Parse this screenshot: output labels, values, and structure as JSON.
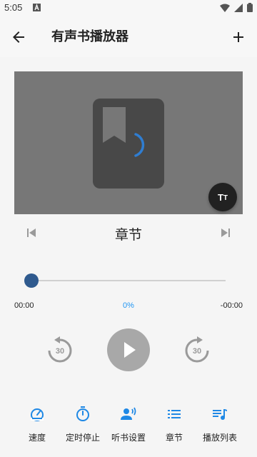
{
  "status_bar": {
    "time": "5:05"
  },
  "app_bar": {
    "title": "有声书播放器"
  },
  "cover": {
    "text_size_button": {
      "big": "T",
      "small": "T"
    }
  },
  "player": {
    "chapter_title": "章节",
    "progress": 0,
    "time_elapsed": "00:00",
    "progress_percent": "0%",
    "time_remaining": "-00:00",
    "rewind_seconds": "30",
    "forward_seconds": "30"
  },
  "bottom_nav": {
    "items": [
      {
        "label": "速度",
        "icon": "speedometer-icon"
      },
      {
        "label": "定时停止",
        "icon": "timer-icon"
      },
      {
        "label": "听书设置",
        "icon": "voice-settings-icon"
      },
      {
        "label": "章节",
        "icon": "list-icon"
      },
      {
        "label": "播放列表",
        "icon": "playlist-icon"
      }
    ]
  },
  "colors": {
    "accent": "#2196f3",
    "seek_thumb": "#2f5a8e",
    "cover_bg": "#777777",
    "play_button": "#a8a8a8",
    "icon_blue": "#1e88e5"
  }
}
